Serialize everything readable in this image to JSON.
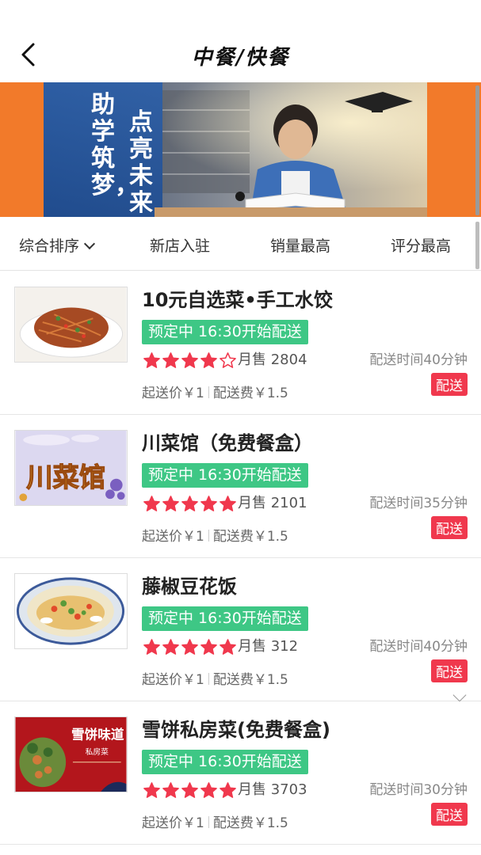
{
  "header": {
    "title": "中餐/快餐",
    "back_icon": "chevron-left-icon"
  },
  "banner": {
    "text_left": "助学筑梦，",
    "text_right": "点亮未来"
  },
  "sort_tabs": [
    {
      "label": "综合排序"
    },
    {
      "label": "新店入驻"
    },
    {
      "label": "销量最高"
    },
    {
      "label": "评分最高"
    }
  ],
  "colors": {
    "accent_green": "#3ec785",
    "star_red": "#f0384d",
    "badge_red": "#f0384d",
    "banner_orange": "#f27a2a"
  },
  "shops": [
    {
      "name": "10元自选菜•手工水饺",
      "preorder": "预定中 16:30开始配送",
      "rating": 4,
      "sales": "月售 2804",
      "delivery_time": "配送时间40分钟",
      "min_price": "起送价￥1",
      "delivery_fee": "配送费￥1.5",
      "badge": "配送",
      "thumb": "dish-stirfry-image"
    },
    {
      "name": "川菜馆（免费餐盒）",
      "preorder": "预定中 16:30开始配送",
      "rating": 5,
      "sales": "月售 2101",
      "delivery_time": "配送时间35分钟",
      "min_price": "起送价￥1",
      "delivery_fee": "配送费￥1.5",
      "badge": "配送",
      "thumb": "sichuan-sign-image",
      "thumb_text": "川菜馆"
    },
    {
      "name": "藤椒豆花饭",
      "preorder": "预定中 16:30开始配送",
      "rating": 5,
      "sales": "月售 312",
      "delivery_time": "配送时间40分钟",
      "min_price": "起送价￥1",
      "delivery_fee": "配送费￥1.5",
      "badge": "配送",
      "thumb": "tofu-dish-image"
    },
    {
      "name": "雪饼私房菜(免费餐盒)",
      "preorder": "预定中 16:30开始配送",
      "rating": 5,
      "sales": "月售 3703",
      "delivery_time": "配送时间30分钟",
      "min_price": "起送价￥1",
      "delivery_fee": "配送费￥1.5",
      "badge": "配送",
      "thumb": "xuebing-sign-image",
      "thumb_text": "雪饼味道",
      "thumb_sub": "私房菜"
    }
  ]
}
